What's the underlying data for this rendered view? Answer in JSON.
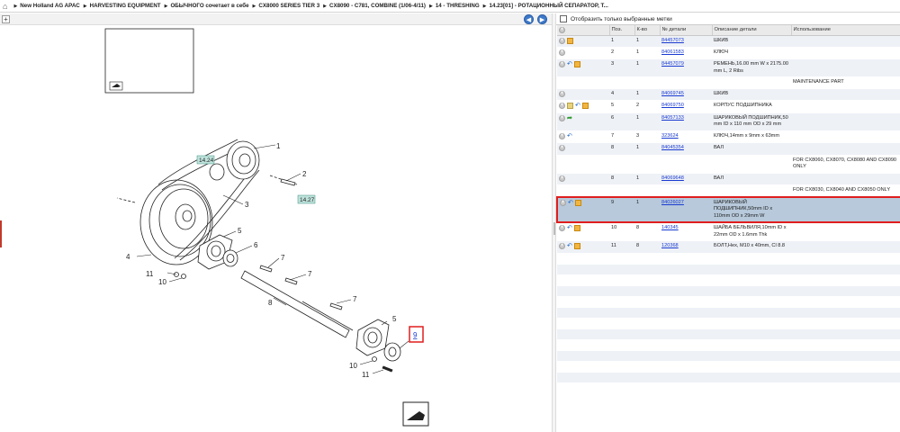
{
  "breadcrumb": {
    "home_icon": "home-icon",
    "items": [
      "New Holland AG APAC",
      "HARVESTING EQUIPMENT",
      "ОБЫЧНОГО сочетает в себе",
      "CX8000 SERIES TIER 3",
      "CX8090 - C781, COMBINE (1/06-4/11)",
      "14 - THRESHING",
      "14.23[01] - РОТАЦИОННЫЙ СЕПАРАТОР, Т..."
    ]
  },
  "diagram": {
    "callouts": [
      "1",
      "2",
      "3",
      "4",
      "5",
      "6",
      "7",
      "7",
      "8",
      "7",
      "5",
      "9",
      "10",
      "11",
      "10",
      "11"
    ],
    "tags": [
      "14.24",
      "14.27"
    ],
    "highlighted_callout": "9"
  },
  "filter": {
    "label": "Отобразить только выбранные метки"
  },
  "table": {
    "headers": [
      "",
      "Поз.",
      "К-во",
      "№ детали",
      "Описание детали",
      "Использование"
    ],
    "rows": [
      {
        "icons": [
          "plus",
          "box"
        ],
        "pos": "1",
        "qty": "1",
        "part": "84457073",
        "desc": "ШКИВ",
        "usage": ""
      },
      {
        "icons": [
          "plus"
        ],
        "pos": "2",
        "qty": "1",
        "part": "84061583",
        "desc": "КЛЮЧ",
        "usage": ""
      },
      {
        "icons": [
          "plus",
          "info",
          "box"
        ],
        "pos": "3",
        "qty": "1",
        "part": "84457079",
        "desc": "РЕМЕНЬ,16.00 mm W x 2175.00 mm L, 2 Ribs",
        "usage": ""
      },
      {
        "icons": [],
        "pos": "",
        "qty": "",
        "part": "",
        "desc": "",
        "usage": "MAINTENANCE PART"
      },
      {
        "icons": [
          "plus"
        ],
        "pos": "4",
        "qty": "1",
        "part": "84069745",
        "desc": "ШКИВ",
        "usage": ""
      },
      {
        "icons": [
          "plus",
          "note",
          "info",
          "box"
        ],
        "pos": "5",
        "qty": "2",
        "part": "84069750",
        "desc": "КОРПУС ПОДШИПНИКА",
        "usage": ""
      },
      {
        "icons": [
          "plus",
          "arrow"
        ],
        "pos": "6",
        "qty": "1",
        "part": "84057133",
        "desc": "ШАРИКОВЫЙ ПОДШИПНИК,50 mm ID x 110 mm OD x 29 mm",
        "usage": ""
      },
      {
        "icons": [
          "plus",
          "info"
        ],
        "pos": "7",
        "qty": "3",
        "part": "323624",
        "desc": "КЛЮЧ,14mm x 9mm x 63mm",
        "usage": ""
      },
      {
        "icons": [
          "plus"
        ],
        "pos": "8",
        "qty": "1",
        "part": "84045354",
        "desc": "ВАЛ",
        "usage": ""
      },
      {
        "icons": [],
        "pos": "",
        "qty": "",
        "part": "",
        "desc": "",
        "usage": "FOR CX8060, CX8070, CX8080 AND CX8090 ONLY"
      },
      {
        "icons": [
          "plus"
        ],
        "pos": "8",
        "qty": "1",
        "part": "84069648",
        "desc": "ВАЛ",
        "usage": ""
      },
      {
        "icons": [],
        "pos": "",
        "qty": "",
        "part": "",
        "desc": "",
        "usage": "FOR CX8030, CX8040 AND CX8050 ONLY"
      },
      {
        "icons": [
          "plus",
          "info",
          "box"
        ],
        "pos": "9",
        "qty": "1",
        "part": "84026027",
        "desc": "ШАРИКОВЫЙ ПОДШИПНИК,50mm ID x 110mm OD x 29mm W",
        "usage": "",
        "selected": true
      },
      {
        "icons": [
          "plus",
          "info",
          "box"
        ],
        "pos": "10",
        "qty": "8",
        "part": "140345",
        "desc": "ШАЙБА БЕЛЬВИЛЯ,10mm ID x 22mm OD x 1.6mm Thk",
        "usage": ""
      },
      {
        "icons": [
          "plus",
          "info",
          "box"
        ],
        "pos": "11",
        "qty": "8",
        "part": "120368",
        "desc": "БОЛТ,Hex, M10 x 40mm, Cl 8.8",
        "usage": ""
      }
    ]
  }
}
